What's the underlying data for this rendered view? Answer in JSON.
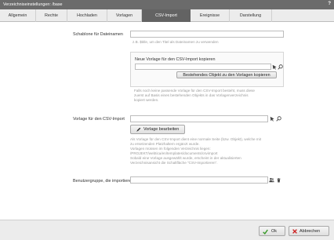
{
  "window": {
    "title": "Verzeichniseinstellungen: /base",
    "help": "?"
  },
  "tabs": [
    {
      "label": "Allgemein"
    },
    {
      "label": "Rechte"
    },
    {
      "label": "Hochladen"
    },
    {
      "label": "Vorlagen"
    },
    {
      "label": "CSV-Import",
      "active": true
    },
    {
      "label": "Ereignisse"
    },
    {
      "label": "Darstellung"
    }
  ],
  "form": {
    "schablone": {
      "label": "Schablone für Dateinamen",
      "value": "",
      "hint": "z.B. $title, um den Titel als Dateinamen zu verwenden"
    },
    "new_template": {
      "heading": "Neue Vorlage für den CSV-Import kopieren",
      "value": "",
      "button": "Bestehendes Objekt zu den Vorlagen kopieren",
      "hint": [
        "Falls noch keine passende Vorlage für den CSV-Import besteht, muss diese",
        "zuerst auf Basis eines bestehenden Objekts in das Vorlagenverzeichnis",
        "kopiert werden."
      ]
    },
    "vorlage": {
      "label": "Vorlage für den CSV-Import",
      "value": "",
      "button": "Vorlage bearbeiten",
      "hint": [
        "Als Vorlage für den CSV-Import dient eine normale Seite (bzw. Objekt), welche mit",
        "zu ersetzenden Platzhaltern ergänzt wurde.",
        "Vorlagen müssen im folgenden Verzeichnis liegen:",
        "/PROJEKT/webtica/en/templates/documents/csvimport",
        "Sobald eine Vorlage ausgewählt wurde, erscheint in der aktualisierten",
        "Verzeichnisansicht die Schaltfläche \"CSV-Importieren\"."
      ]
    },
    "benutzergruppe": {
      "label": "Benutzergruppe, die importieren darf",
      "value": ""
    }
  },
  "footer": {
    "ok": "Ok",
    "cancel": "Abbrechen"
  },
  "colors": {
    "titlebar": "#6b6b6b",
    "active_tab": "#636363",
    "ok_green": "#3a9a2a",
    "cancel_red": "#cc2222"
  }
}
